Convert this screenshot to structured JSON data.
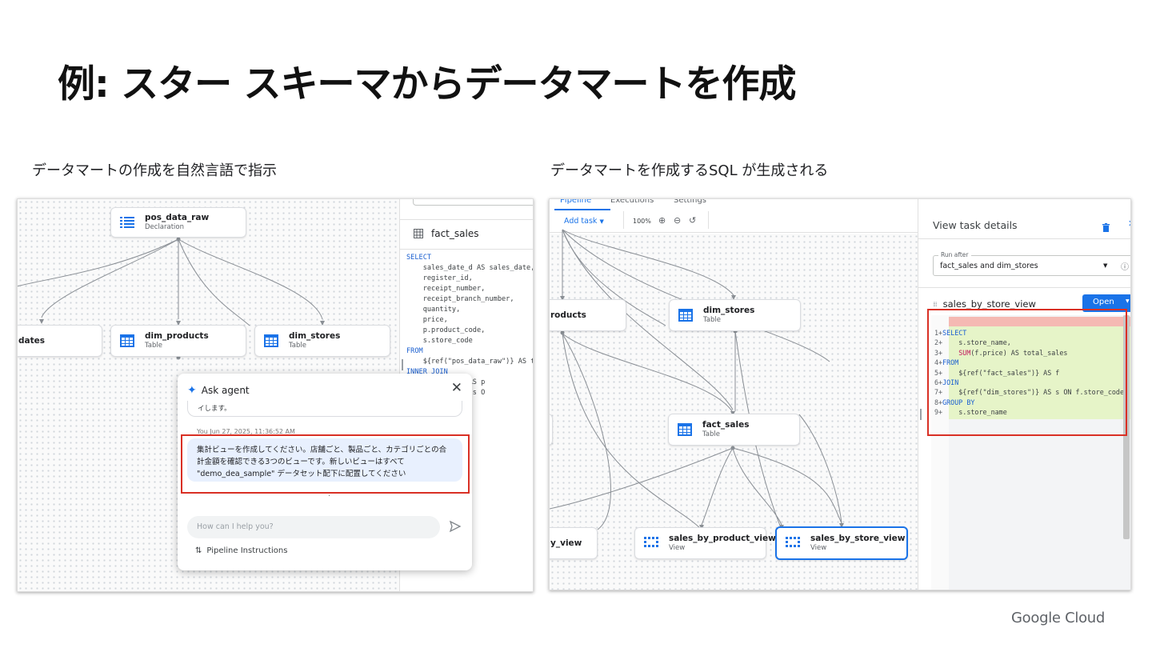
{
  "slide_title": "例: スター スキーマからデータマートを作成",
  "left": {
    "caption": "データマートの作成を自然言語で指示",
    "nodes": {
      "pos": {
        "name": "pos_data_raw",
        "type": "Declaration"
      },
      "dates": {
        "name": "dates"
      },
      "products": {
        "name": "dim_products",
        "type": "Table"
      },
      "stores": {
        "name": "dim_stores",
        "type": "Table"
      }
    },
    "sql_panel": {
      "title": "fact_sales",
      "lines": [
        "SELECT",
        "    sales_date_d AS sales_date,",
        "    register_id,",
        "    receipt_number,",
        "    receipt_branch_number,",
        "    quantity,",
        "    price,",
        "    p.product_code,",
        "    s.store_code",
        "FROM",
        "    ${ref(\"pos_data_raw\")} AS t",
        "INNER JOIN",
        "    roducts\")} AS p",
        "    tores\")} AS s O"
      ]
    },
    "agent": {
      "title": "Ask agent",
      "prev_text": "イします。",
      "msg_meta": "You   Jun 27, 2025, 11:36:52 AM",
      "message": "集計ビューを作成してください。店舗ごと、製品ごと、カテゴリごとの合計金額を確認できる3つのビューです。新しいビューはすべて \"demo_dea_sample\" データセット配下に配置してください",
      "loading": "·",
      "placeholder": "How can I help you?",
      "pipeline_link": "Pipeline Instructions"
    }
  },
  "right": {
    "caption": "データマートを作成するSQL が生成される",
    "tabs": [
      "Pipeline",
      "Executions",
      "Settings"
    ],
    "toolbar": {
      "add_task": "Add task",
      "zoom": "100%"
    },
    "nodes": {
      "products": {
        "name": "roducts"
      },
      "stores": {
        "name": "dim_stores",
        "type": "Table"
      },
      "fact": {
        "name": "fact_sales",
        "type": "Table"
      },
      "view_left": {
        "name": "y_view"
      },
      "product_view": {
        "name": "sales_by_product_view",
        "type": "View"
      },
      "store_view": {
        "name": "sales_by_store_view",
        "type": "View"
      }
    },
    "details": {
      "title": "View task details",
      "run_after_label": "Run after",
      "run_after_value": "fact_sales and dim_stores",
      "task_name": "sales_by_store_view",
      "open_label": "Open",
      "sql": [
        {
          "n": "1",
          "kw": "SELECT",
          "fn": "",
          "text": ""
        },
        {
          "n": "2",
          "kw": "",
          "fn": "",
          "text": "    s.store_name,"
        },
        {
          "n": "3",
          "kw": "",
          "fn": "    SUM",
          "text": "(f.price) AS total_sales"
        },
        {
          "n": "4",
          "kw": "FROM",
          "fn": "",
          "text": ""
        },
        {
          "n": "5",
          "kw": "",
          "fn": "",
          "text": "    ${ref(\"fact_sales\")} AS f"
        },
        {
          "n": "6",
          "kw": "JOIN",
          "fn": "",
          "text": ""
        },
        {
          "n": "7",
          "kw": "",
          "fn": "",
          "text": "    ${ref(\"dim_stores\")} AS s ON f.store_code"
        },
        {
          "n": "8",
          "kw": "GROUP BY",
          "fn": "",
          "text": ""
        },
        {
          "n": "9",
          "kw": "",
          "fn": "",
          "text": "    s.store_name"
        }
      ]
    }
  },
  "brand": "Google Cloud",
  "colors": {
    "accent": "#1a73e8",
    "highlight": "#d93025",
    "added_line": "#e6f4c8"
  }
}
